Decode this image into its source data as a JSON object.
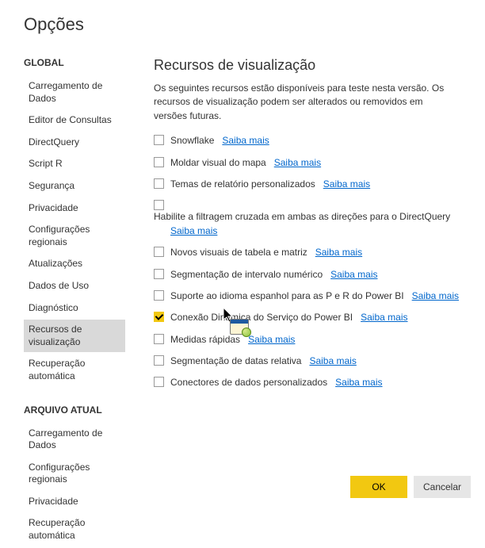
{
  "dialog": {
    "title": "Opções"
  },
  "sidebar": {
    "sections": [
      {
        "header": "GLOBAL",
        "items": [
          "Carregamento de Dados",
          "Editor de Consultas",
          "DirectQuery",
          "Script R",
          "Segurança",
          "Privacidade",
          "Configurações regionais",
          "Atualizações",
          "Dados de Uso",
          "Diagnóstico",
          "Recursos de visualização",
          "Recuperação automática"
        ]
      },
      {
        "header": "ARQUIVO ATUAL",
        "items": [
          "Carregamento de Dados",
          "Configurações regionais",
          "Privacidade",
          "Recuperação automática"
        ]
      }
    ],
    "selected": "Recursos de visualização"
  },
  "main": {
    "title": "Recursos de visualização",
    "description": "Os seguintes recursos estão disponíveis para teste nesta versão. Os recursos de visualização podem ser alterados ou removidos em versões futuras.",
    "learn_more_text": "Saiba mais",
    "features": [
      {
        "label": "Snowflake",
        "checked": false
      },
      {
        "label": "Moldar visual do mapa",
        "checked": false
      },
      {
        "label": "Temas de relatório personalizados",
        "checked": false
      },
      {
        "label": "Habilite a filtragem cruzada em ambas as direções para o DirectQuery",
        "checked": false,
        "wrap": true
      },
      {
        "label": "Novos visuais de tabela e matriz",
        "checked": false
      },
      {
        "label": "Segmentação de intervalo numérico",
        "checked": false
      },
      {
        "label": "Suporte ao idioma espanhol para as P e R do Power BI",
        "checked": false
      },
      {
        "label": "Conexão Dinâmica do Serviço do Power BI",
        "checked": true
      },
      {
        "label": "Medidas rápidas",
        "checked": false,
        "obscured": true
      },
      {
        "label": "Segmentação de datas relativa",
        "checked": false,
        "obscured": true
      },
      {
        "label": "Conectores de dados personalizados",
        "checked": false
      }
    ]
  },
  "footer": {
    "ok": "OK",
    "cancel": "Cancelar"
  }
}
